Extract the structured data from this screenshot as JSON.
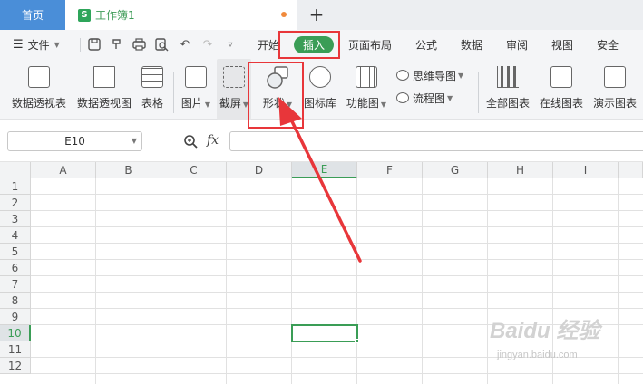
{
  "tabs": {
    "home": "首页",
    "document": "工作簿1",
    "new_tab": "+"
  },
  "file_menu": "文件",
  "menu": [
    "开始",
    "插入",
    "页面布局",
    "公式",
    "数据",
    "审阅",
    "视图",
    "安全"
  ],
  "ribbon": {
    "pivot_table": "数据透视表",
    "pivot_chart": "数据透视图",
    "table": "表格",
    "picture": "图片",
    "screenshot": "截屏",
    "shape": "形状",
    "icon_library": "图标库",
    "function_chart": "功能图",
    "mind_map": "思维导图",
    "flowchart": "流程图",
    "all_charts": "全部图表",
    "online_charts": "在线图表",
    "demo_charts": "演示图表"
  },
  "formula": {
    "name_box": "E10",
    "fx": "fx",
    "value": ""
  },
  "grid": {
    "columns": [
      "A",
      "B",
      "C",
      "D",
      "E",
      "F",
      "G",
      "H",
      "I"
    ],
    "rows": [
      "1",
      "2",
      "3",
      "4",
      "5",
      "6",
      "7",
      "8",
      "9",
      "10",
      "11",
      "12"
    ],
    "selected_cell": "E10"
  },
  "colors": {
    "accent": "#3a9d56",
    "annotation": "#e8363a",
    "home_tab": "#4a8ed8"
  },
  "watermark": {
    "brand": "Baidu 经验",
    "url": "jingyan.baidu.com"
  }
}
